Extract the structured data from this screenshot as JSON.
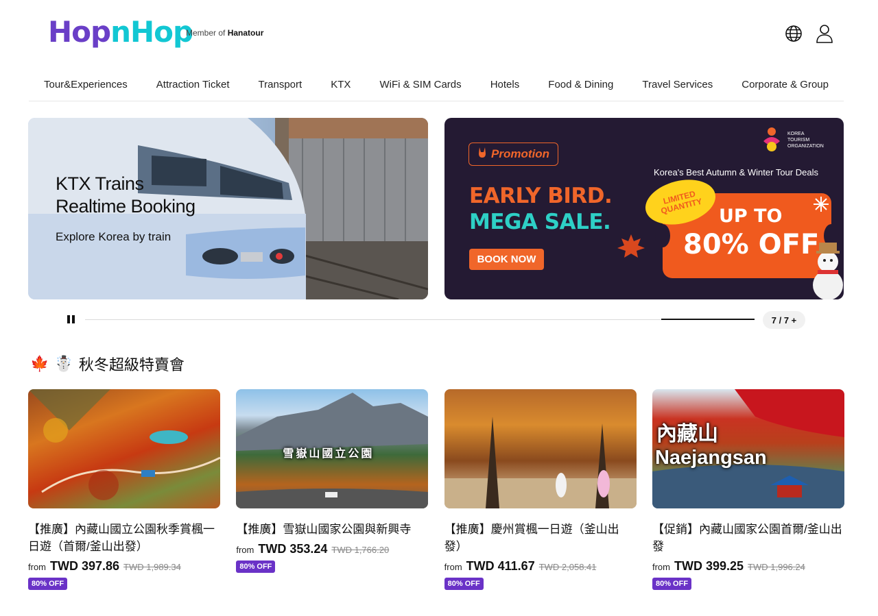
{
  "header": {
    "logo_part1": "Hop",
    "logo_part2": "n",
    "logo_part3": "Hop",
    "member_prefix": "Member of",
    "member_brand": "Hanatour",
    "globe_icon": "globe-icon",
    "user_icon": "user-icon"
  },
  "nav": {
    "items": [
      "Tour&Experiences",
      "Attraction Ticket",
      "Transport",
      "KTX",
      "WiFi & SIM Cards",
      "Hotels",
      "Food & Dining",
      "Travel Services",
      "Corporate & Group"
    ]
  },
  "banners": {
    "ktx": {
      "title_line1": "KTX Trains",
      "title_line2": "Realtime Booking",
      "subtitle": "Explore Korea by train"
    },
    "promo": {
      "tag": "Promotion",
      "headline": "Korea's Best Autumn & Winter Tour Deals",
      "early": "EARLY BIRD.",
      "mega": "MEGA SALE.",
      "book": "BOOK NOW",
      "limited": "LIMITED QUANTITY",
      "up_to": "UP TO",
      "off": "80% OFF",
      "org_line1": "KOREA",
      "org_line2": "TOURISM",
      "org_line3": "ORGANIZATION"
    }
  },
  "slider": {
    "counter": "7 / 7 +",
    "progress": 1.0
  },
  "section": {
    "emoji1": "🍁",
    "emoji2": "☃️",
    "title": "秋冬超級特賣會"
  },
  "products": [
    {
      "title": "【推廣】內藏山國立公園秋季賞楓一日遊（首爾/釜山出發）",
      "from": "from",
      "price": "TWD 397.86",
      "original": "TWD 1,989.34",
      "badge": "80% OFF",
      "image_caption": ""
    },
    {
      "title": "【推廣】雪嶽山國家公園與新興寺",
      "from": "from",
      "price": "TWD 353.24",
      "original": "TWD 1,766.20",
      "badge": "80% OFF",
      "image_caption": "雪嶽山國立公園"
    },
    {
      "title": "【推廣】慶州賞楓一日遊（釜山出發）",
      "from": "from",
      "price": "TWD 411.67",
      "original": "TWD 2,058.41",
      "badge": "80% OFF",
      "image_caption": ""
    },
    {
      "title": "【促銷】內藏山國家公園首爾/釜山出發",
      "from": "from",
      "price": "TWD 399.25",
      "original": "TWD 1,996.24",
      "badge": "80% OFF",
      "image_caption_line1": "內藏山",
      "image_caption_line2": "Naejangsan"
    }
  ],
  "colors": {
    "brand_purple": "#6a3fc7",
    "brand_cyan": "#12c7d3",
    "promo_orange": "#f0662a",
    "badge_purple": "#6a32c7"
  }
}
